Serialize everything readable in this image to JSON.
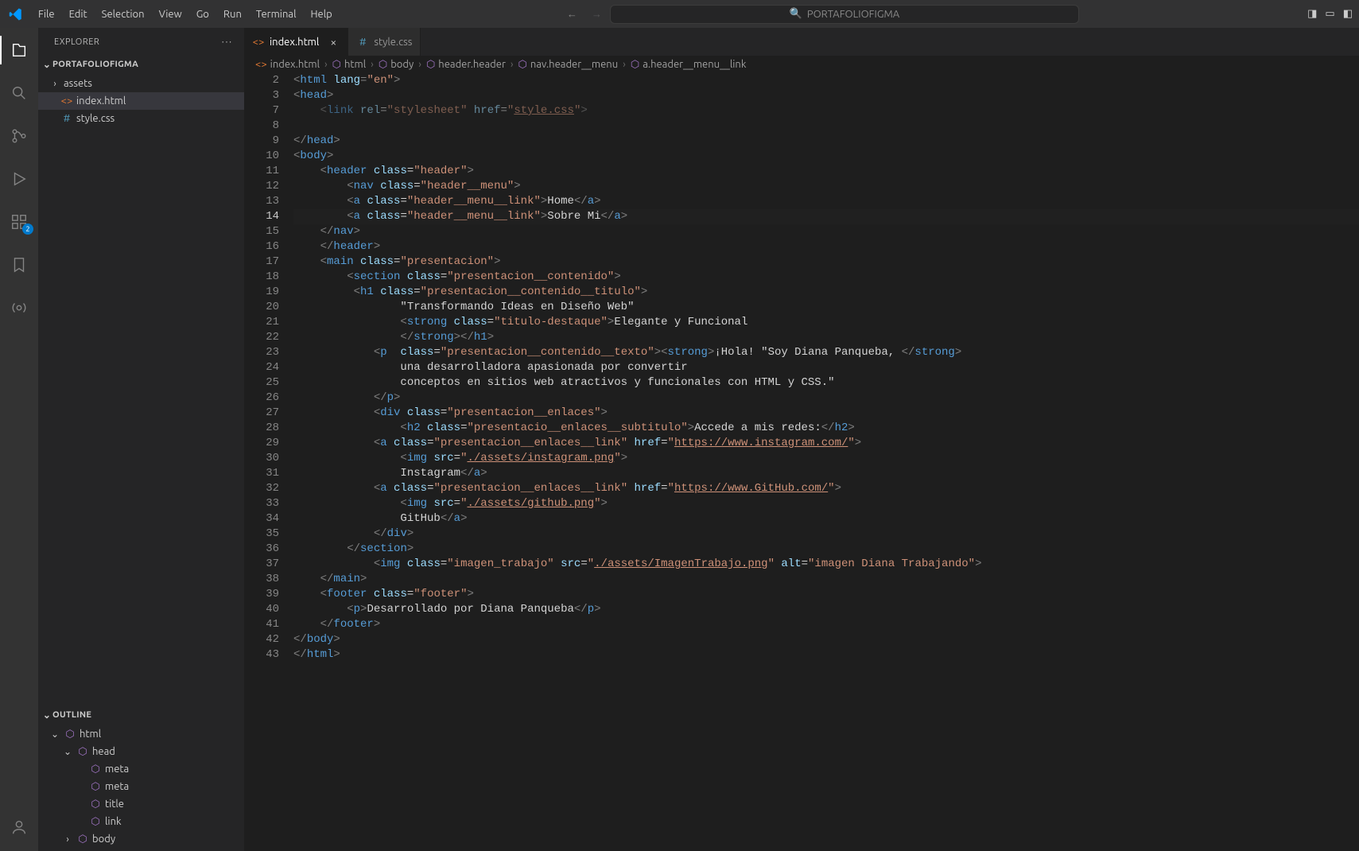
{
  "app": {
    "search_placeholder": "PORTAFOLIOFIGMA"
  },
  "menubar": [
    "File",
    "Edit",
    "Selection",
    "View",
    "Go",
    "Run",
    "Terminal",
    "Help"
  ],
  "activitybar": {
    "ext_badge": "2"
  },
  "sidebar": {
    "title": "EXPLORER",
    "project": "PORTAFOLIOFIGMA",
    "items": [
      {
        "label": "assets",
        "type": "folder"
      },
      {
        "label": "index.html",
        "type": "html",
        "selected": true
      },
      {
        "label": "style.css",
        "type": "css"
      }
    ],
    "outline_title": "OUTLINE",
    "outline": [
      {
        "label": "html",
        "depth": 0
      },
      {
        "label": "head",
        "depth": 1
      },
      {
        "label": "meta",
        "depth": 2
      },
      {
        "label": "meta",
        "depth": 2
      },
      {
        "label": "title",
        "depth": 2
      },
      {
        "label": "link",
        "depth": 2
      },
      {
        "label": "body",
        "depth": 1,
        "collapsed": true
      }
    ]
  },
  "tabs": [
    {
      "label": "index.html",
      "icon": "html",
      "active": true,
      "close": true
    },
    {
      "label": "style.css",
      "icon": "css",
      "active": false,
      "close": false
    }
  ],
  "breadcrumb": [
    {
      "label": "index.html",
      "icon": "html"
    },
    {
      "label": "html",
      "icon": "sym"
    },
    {
      "label": "body",
      "icon": "sym"
    },
    {
      "label": "header.header",
      "icon": "sym"
    },
    {
      "label": "nav.header__menu",
      "icon": "sym"
    },
    {
      "label": "a.header__menu__link",
      "icon": "sym"
    }
  ],
  "editor": {
    "active_line": "14",
    "line_numbers": [
      "2",
      "3",
      "7",
      "8",
      "9",
      "10",
      "11",
      "12",
      "13",
      "14",
      "15",
      "16",
      "17",
      "18",
      "19",
      "20",
      "21",
      "22",
      "23",
      "24",
      "25",
      "26",
      "27",
      "28",
      "29",
      "30",
      "31",
      "32",
      "33",
      "34",
      "35",
      "36",
      "37",
      "38",
      "39",
      "40",
      "41",
      "42",
      "43"
    ],
    "lines": [
      {
        "ind": 0,
        "html": "<span class='t-brk'>&lt;</span><span class='t-tag'>html</span> <span class='t-attr'>lang</span><span class='t-brk'>=</span><span class='t-str'>\"en\"</span><span class='t-brk'>&gt;</span>"
      },
      {
        "ind": 0,
        "html": "<span class='t-brk'>&lt;</span><span class='t-tag'>head</span><span class='t-brk'>&gt;</span>"
      },
      {
        "ind": 1,
        "html": "<span class='t-brk'>&lt;</span><span class='t-tag'>link</span> <span class='t-attr'>rel</span>=<span class='t-str'>\"stylesheet\"</span> <span class='t-attr'>href</span>=<span class='t-str'>\"</span><span class='t-str-u'>style.css</span><span class='t-str'>\"</span><span class='t-brk'>&gt;</span>",
        "faded": true
      },
      {
        "ind": 0,
        "html": ""
      },
      {
        "ind": 0,
        "html": "<span class='t-brk'>&lt;/</span><span class='t-tag'>head</span><span class='t-brk'>&gt;</span>"
      },
      {
        "ind": 0,
        "html": "<span class='t-brk'>&lt;</span><span class='t-tag'>body</span><span class='t-brk'>&gt;</span>"
      },
      {
        "ind": 1,
        "html": "<span class='t-brk'>&lt;</span><span class='t-tag'>header</span> <span class='t-attr'>class</span>=<span class='t-str'>\"header\"</span><span class='t-brk'>&gt;</span>"
      },
      {
        "ind": 2,
        "html": "<span class='t-brk'>&lt;</span><span class='t-tag'>nav</span> <span class='t-attr'>class</span>=<span class='t-str'>\"header__menu\"</span><span class='t-brk'>&gt;</span>"
      },
      {
        "ind": 2,
        "html": "<span class='t-brk'>&lt;</span><span class='t-tag'>a</span> <span class='t-attr'>class</span>=<span class='t-str'>\"header__menu__link\"</span><span class='t-brk'>&gt;</span>Home<span class='t-brk'>&lt;/</span><span class='t-tag'>a</span><span class='t-brk'>&gt;</span>"
      },
      {
        "ind": 2,
        "html": "<span class='t-brk'>&lt;</span><span class='t-tag'>a</span> <span class='t-attr'>class</span>=<span class='t-str'>\"header__menu__link\"</span><span class='t-brk'>&gt;</span>Sobre Mi<span class='t-brk'>&lt;/</span><span class='t-tag'>a</span><span class='t-brk'>&gt;</span>",
        "active": true
      },
      {
        "ind": 1,
        "html": "<span class='t-brk'>&lt;/</span><span class='t-tag'>nav</span><span class='t-brk'>&gt;</span>"
      },
      {
        "ind": 1,
        "html": "<span class='t-brk'>&lt;/</span><span class='t-tag'>header</span><span class='t-brk'>&gt;</span>"
      },
      {
        "ind": 1,
        "html": "<span class='t-brk'>&lt;</span><span class='t-tag'>main</span> <span class='t-attr'>class</span>=<span class='t-str'>\"presentacion\"</span><span class='t-brk'>&gt;</span>"
      },
      {
        "ind": 2,
        "html": "<span class='t-brk'>&lt;</span><span class='t-tag'>section</span> <span class='t-attr'>class</span>=<span class='t-str'>\"presentacion__contenido\"</span><span class='t-brk'>&gt;</span>"
      },
      {
        "ind": 2,
        "html": " <span class='t-brk'>&lt;</span><span class='t-tag'>h1</span> <span class='t-attr'>class</span>=<span class='t-str'>\"presentacion__contenido__titulo\"</span><span class='t-brk'>&gt;</span>"
      },
      {
        "ind": 4,
        "html": "\"Transformando Ideas en Diseño Web\""
      },
      {
        "ind": 4,
        "html": "<span class='t-brk'>&lt;</span><span class='t-tag'>strong</span> <span class='t-attr'>class</span>=<span class='t-str'>\"titulo-destaque\"</span><span class='t-brk'>&gt;</span>Elegante y Funcional"
      },
      {
        "ind": 4,
        "html": "<span class='t-brk'>&lt;/</span><span class='t-tag'>strong</span><span class='t-brk'>&gt;&lt;/</span><span class='t-tag'>h1</span><span class='t-brk'>&gt;</span>"
      },
      {
        "ind": 3,
        "html": "<span class='t-brk'>&lt;</span><span class='t-tag'>p</span>  <span class='t-attr'>class</span>=<span class='t-str'>\"presentacion__contenido__texto\"</span><span class='t-brk'>&gt;&lt;</span><span class='t-tag'>strong</span><span class='t-brk'>&gt;</span>¡Hola! \"Soy Diana Panqueba, <span class='t-brk'>&lt;/</span><span class='t-tag'>strong</span><span class='t-brk'>&gt;</span>"
      },
      {
        "ind": 4,
        "html": "una desarrolladora apasionada por convertir "
      },
      {
        "ind": 4,
        "html": "conceptos en sitios web atractivos y funcionales con HTML y CSS.\""
      },
      {
        "ind": 3,
        "html": "<span class='t-brk'>&lt;/</span><span class='t-tag'>p</span><span class='t-brk'>&gt;</span>"
      },
      {
        "ind": 3,
        "html": "<span class='t-brk'>&lt;</span><span class='t-tag'>div</span> <span class='t-attr'>class</span>=<span class='t-str'>\"presentacion__enlaces\"</span><span class='t-brk'>&gt;</span>"
      },
      {
        "ind": 4,
        "html": "<span class='t-brk'>&lt;</span><span class='t-tag'>h2</span> <span class='t-attr'>class</span>=<span class='t-str'>\"presentacio__enlaces__subtitulo\"</span><span class='t-brk'>&gt;</span>Accede a mis redes:<span class='t-brk'>&lt;/</span><span class='t-tag'>h2</span><span class='t-brk'>&gt;</span>"
      },
      {
        "ind": 3,
        "html": "<span class='t-brk'>&lt;</span><span class='t-tag'>a</span> <span class='t-attr'>class</span>=<span class='t-str'>\"presentacion__enlaces__link\"</span> <span class='t-attr'>href</span>=<span class='t-str'>\"</span><span class='t-str-u'>https://www.instagram.com/</span><span class='t-str'>\"</span><span class='t-brk'>&gt;</span>"
      },
      {
        "ind": 4,
        "html": "<span class='t-brk'>&lt;</span><span class='t-tag'>img</span> <span class='t-attr'>src</span>=<span class='t-str'>\"</span><span class='t-str-u'>./assets/instagram.png</span><span class='t-str'>\"</span><span class='t-brk'>&gt;</span>"
      },
      {
        "ind": 4,
        "html": "Instagram<span class='t-brk'>&lt;/</span><span class='t-tag'>a</span><span class='t-brk'>&gt;</span>"
      },
      {
        "ind": 3,
        "html": "<span class='t-brk'>&lt;</span><span class='t-tag'>a</span> <span class='t-attr'>class</span>=<span class='t-str'>\"presentacion__enlaces__link\"</span> <span class='t-attr'>href</span>=<span class='t-str'>\"</span><span class='t-str-u'>https://www.GitHub.com/</span><span class='t-str'>\"</span><span class='t-brk'>&gt;</span>"
      },
      {
        "ind": 4,
        "html": "<span class='t-brk'>&lt;</span><span class='t-tag'>img</span> <span class='t-attr'>src</span>=<span class='t-str'>\"</span><span class='t-str-u'>./assets/github.png</span><span class='t-str'>\"</span><span class='t-brk'>&gt;</span>"
      },
      {
        "ind": 4,
        "html": "GitHub<span class='t-brk'>&lt;/</span><span class='t-tag'>a</span><span class='t-brk'>&gt;</span>"
      },
      {
        "ind": 3,
        "html": "<span class='t-brk'>&lt;/</span><span class='t-tag'>div</span><span class='t-brk'>&gt;</span>"
      },
      {
        "ind": 2,
        "html": "<span class='t-brk'>&lt;/</span><span class='t-tag'>section</span><span class='t-brk'>&gt;</span>"
      },
      {
        "ind": 3,
        "html": "<span class='t-brk'>&lt;</span><span class='t-tag'>img</span> <span class='t-attr'>class</span>=<span class='t-str'>\"imagen_trabajo\"</span> <span class='t-attr'>src</span>=<span class='t-str'>\"</span><span class='t-str-u'>./assets/ImagenTrabajo.png</span><span class='t-str'>\"</span> <span class='t-attr'>alt</span>=<span class='t-str'>\"imagen Diana Trabajando\"</span><span class='t-brk'>&gt;</span>"
      },
      {
        "ind": 1,
        "html": "<span class='t-brk'>&lt;/</span><span class='t-tag'>main</span><span class='t-brk'>&gt;</span>"
      },
      {
        "ind": 1,
        "html": "<span class='t-brk'>&lt;</span><span class='t-tag'>footer</span> <span class='t-attr'>class</span>=<span class='t-str'>\"footer\"</span><span class='t-brk'>&gt;</span>"
      },
      {
        "ind": 2,
        "html": "<span class='t-brk'>&lt;</span><span class='t-tag'>p</span><span class='t-brk'>&gt;</span>Desarrollado por Diana Panqueba<span class='t-brk'>&lt;/</span><span class='t-tag'>p</span><span class='t-brk'>&gt;</span>"
      },
      {
        "ind": 1,
        "html": "<span class='t-brk'>&lt;/</span><span class='t-tag'>footer</span><span class='t-brk'>&gt;</span>"
      },
      {
        "ind": 0,
        "html": "<span class='t-brk'>&lt;/</span><span class='t-tag'>body</span><span class='t-brk'>&gt;</span>"
      },
      {
        "ind": 0,
        "html": "<span class='t-brk'>&lt;/</span><span class='t-tag'>html</span><span class='t-brk'>&gt;</span>"
      }
    ]
  }
}
